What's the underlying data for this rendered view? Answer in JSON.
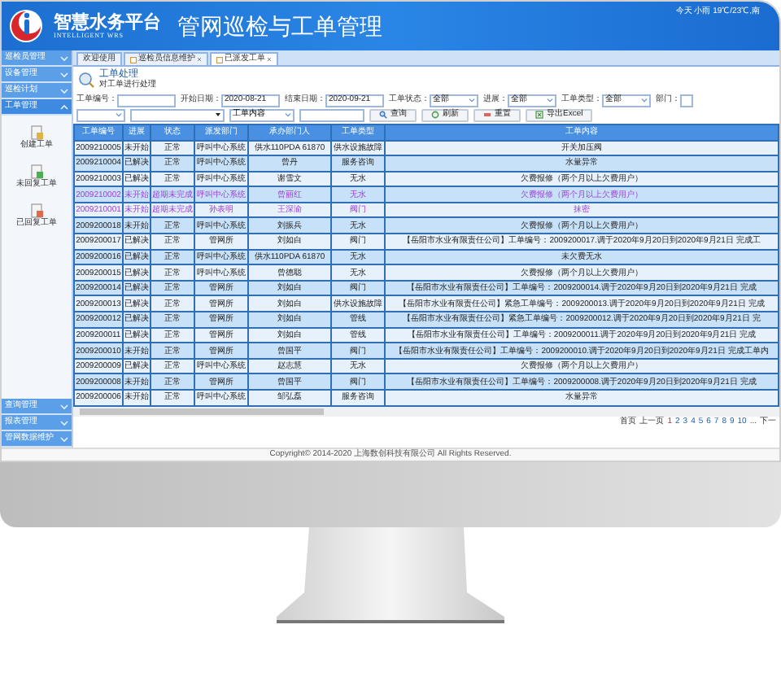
{
  "header": {
    "brand": "智慧水务平台",
    "brand_sub": "INTELLIGENT WRS",
    "title": "管网巡检与工单管理",
    "weather": "今天 小雨 19℃/23℃,南"
  },
  "sidebar": {
    "top_items": [
      {
        "label": "巡检员管理",
        "expanded": false
      },
      {
        "label": "设备管理",
        "expanded": false
      },
      {
        "label": "巡检计划",
        "expanded": false
      },
      {
        "label": "工单管理",
        "expanded": true,
        "children": [
          {
            "label": "创建工单",
            "kind": "create"
          },
          {
            "label": "未回复工单",
            "kind": "pending"
          },
          {
            "label": "已回复工单",
            "kind": "replied"
          }
        ]
      }
    ],
    "bottom_items": [
      {
        "label": "查询管理",
        "expanded": false
      },
      {
        "label": "报表管理",
        "expanded": false
      },
      {
        "label": "管网数据维护",
        "expanded": false
      }
    ]
  },
  "tabs": [
    {
      "label": "欢迎使用",
      "closable": false,
      "selected": false
    },
    {
      "label": "巡检员信息维护",
      "closable": true,
      "selected": false
    },
    {
      "label": "已派发工单",
      "closable": true,
      "selected": true
    }
  ],
  "page_heading": {
    "title": "工单处理",
    "subtitle": "对工单进行处理"
  },
  "filters": [
    {
      "label": "工单编号：",
      "kind": "text"
    },
    {
      "label": "开始日期：",
      "kind": "text",
      "value": "2020-08-21"
    },
    {
      "label": "结束日期：",
      "kind": "text",
      "value": "2020-09-21"
    },
    {
      "label": "工单状态：",
      "kind": "select",
      "value": "全部"
    },
    {
      "label": "进展：",
      "kind": "select",
      "value": "全部"
    },
    {
      "label": "工单类型：",
      "kind": "select",
      "value": "全部"
    },
    {
      "label": "部门：",
      "kind": "text"
    }
  ],
  "search_row": {
    "field_select": "工单内容"
  },
  "buttons": [
    {
      "label": "查询",
      "kind": "search"
    },
    {
      "label": "刷新",
      "kind": "refresh"
    },
    {
      "label": "重置",
      "kind": "reset"
    },
    {
      "label": "导出Excel",
      "kind": "export"
    }
  ],
  "table": {
    "columns": [
      "工单编号",
      "进展",
      "状态",
      "派发部门",
      "承办部门人",
      "工单类型",
      "工单内容"
    ],
    "rows": [
      {
        "overdue": false,
        "cells": [
          "2009210005",
          "未开始",
          "正常",
          "呼叫中心系统",
          "供水110PDA 61870",
          "供水设施故障",
          "开关加压阀"
        ]
      },
      {
        "overdue": false,
        "cells": [
          "2009210004",
          "已解决",
          "正常",
          "呼叫中心系统",
          "曾丹",
          "服务咨询",
          "水量异常"
        ]
      },
      {
        "overdue": false,
        "cells": [
          "2009210003",
          "已解决",
          "正常",
          "呼叫中心系统",
          "谢雪文",
          "无水",
          "欠费报修（两个月以上欠费用户）"
        ]
      },
      {
        "overdue": true,
        "cells": [
          "2009210002",
          "未开始",
          "超期未完成",
          "呼叫中心系统",
          "曾丽红",
          "无水",
          "欠费报修（两个月以上欠费用户）"
        ]
      },
      {
        "overdue": true,
        "cells": [
          "2009210001",
          "未开始",
          "超期未完成",
          "孙表明",
          "王深渝",
          "阀门",
          "抹密"
        ]
      },
      {
        "overdue": false,
        "cells": [
          "2009200018",
          "未开始",
          "正常",
          "呼叫中心系统",
          "刘振兵",
          "无水",
          "欠费报修（两个月以上欠费用户）"
        ]
      },
      {
        "overdue": false,
        "cells": [
          "2009200017",
          "已解决",
          "正常",
          "管网所",
          "刘如白",
          "阀门",
          "【岳阳市水业有限责任公司】工单编号：2009200017.调于2020年9月20日到2020年9月21日 完成工"
        ]
      },
      {
        "overdue": false,
        "cells": [
          "2009200016",
          "已解决",
          "正常",
          "呼叫中心系统",
          "供水110PDA 61870",
          "无水",
          "未欠费无水"
        ]
      },
      {
        "overdue": false,
        "cells": [
          "2009200015",
          "已解决",
          "正常",
          "呼叫中心系统",
          "曾德聪",
          "无水",
          "欠费报修（两个月以上欠费用户）"
        ]
      },
      {
        "overdue": false,
        "cells": [
          "2009200014",
          "已解决",
          "正常",
          "管网所",
          "刘如白",
          "阀门",
          "【岳阳市水业有限责任公司】工单编号：2009200014.调于2020年9月20日到2020年9月21日 完成"
        ]
      },
      {
        "overdue": false,
        "cells": [
          "2009200013",
          "已解决",
          "正常",
          "管网所",
          "刘如白",
          "供水设施故障",
          "【岳阳市水业有限责任公司】紧急工单编号：2009200013.调于2020年9月20日到2020年9月21日 完成"
        ]
      },
      {
        "overdue": false,
        "cells": [
          "2009200012",
          "已解决",
          "正常",
          "管网所",
          "刘如白",
          "管线",
          "【岳阳市水业有限责任公司】紧急工单编号：2009200012.调于2020年9月20日到2020年9月21日 完"
        ]
      },
      {
        "overdue": false,
        "cells": [
          "2009200011",
          "已解决",
          "正常",
          "管网所",
          "刘如白",
          "管线",
          "【岳阳市水业有限责任公司】工单编号：2009200011.调于2020年9月20日到2020年9月21日 完成"
        ]
      },
      {
        "overdue": false,
        "cells": [
          "2009200010",
          "未开始",
          "正常",
          "管网所",
          "曾国平",
          "阀门",
          "【岳阳市水业有限责任公司】工单编号：2009200010.调于2020年9月20日到2020年9月21日 完成工单内"
        ]
      },
      {
        "overdue": false,
        "cells": [
          "2009200009",
          "已解决",
          "正常",
          "呼叫中心系统",
          "赵志慧",
          "无水",
          "欠费报修（两个月以上欠费用户）"
        ]
      },
      {
        "overdue": false,
        "cells": [
          "2009200008",
          "未开始",
          "正常",
          "管网所",
          "曾国平",
          "阀门",
          "【岳阳市水业有限责任公司】工单编号：2009200008.调于2020年9月20日到2020年9月21日 完成"
        ]
      },
      {
        "overdue": false,
        "cells": [
          "2009200006",
          "未开始",
          "正常",
          "呼叫中心系统",
          "邹弘磊",
          "服务咨询",
          "水量异常"
        ]
      }
    ]
  },
  "pager": {
    "first": "首页",
    "prev": "上一页",
    "pages": [
      {
        "label": "1",
        "selected": true
      },
      {
        "label": "2",
        "selected": false
      },
      {
        "label": "3",
        "selected": false
      },
      {
        "label": "4",
        "selected": false
      },
      {
        "label": "5",
        "selected": false
      },
      {
        "label": "6",
        "selected": false
      },
      {
        "label": "7",
        "selected": false
      },
      {
        "label": "8",
        "selected": false
      },
      {
        "label": "9",
        "selected": false
      },
      {
        "label": "10",
        "selected": false
      }
    ],
    "ellipsis": "...",
    "next": "下一"
  },
  "footer": {
    "copyright": "Copyright© 2014-2020 上海数创科技有限公司 All Rights Reserved."
  }
}
